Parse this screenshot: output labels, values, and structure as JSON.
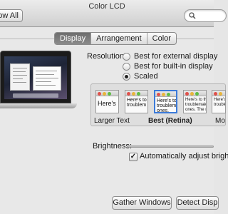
{
  "window": {
    "title": "Color LCD"
  },
  "toolbar": {
    "show_all_label": "ow All"
  },
  "tabs": [
    {
      "label": "Display",
      "active": true
    },
    {
      "label": "Arrangement",
      "active": false
    },
    {
      "label": "Color",
      "active": false
    }
  ],
  "resolution": {
    "label": "Resolution:",
    "options": [
      {
        "label": "Best for external display",
        "checked": false
      },
      {
        "label": "Best for built-in display",
        "checked": false
      },
      {
        "label": "Scaled",
        "checked": true
      }
    ]
  },
  "scaled": {
    "thumbs": [
      {
        "text": "Here's",
        "selected": false
      },
      {
        "text": "Here's to\ntroublem",
        "selected": false
      },
      {
        "text": "Here's to\ntroublemak\nones.",
        "selected": true
      },
      {
        "text": "Here's to th\ntroublemake\nones. The ro",
        "selected": false
      },
      {
        "text": "Here's to\ntrouble",
        "selected": false
      }
    ],
    "captions": {
      "larger": "Larger Text",
      "best": "Best (Retina)",
      "more": "Mo"
    }
  },
  "brightness": {
    "label": "Brightness:",
    "auto_adjust_label": "Automatically adjust bright",
    "auto_adjust_checked": true
  },
  "buttons": {
    "gather": "Gather Windows",
    "detect": "Detect Disp"
  },
  "colors": {
    "selection": "#3b7ad9",
    "close": "#e0504a",
    "minimize": "#e9b53a",
    "zoom": "#5fbd44"
  }
}
